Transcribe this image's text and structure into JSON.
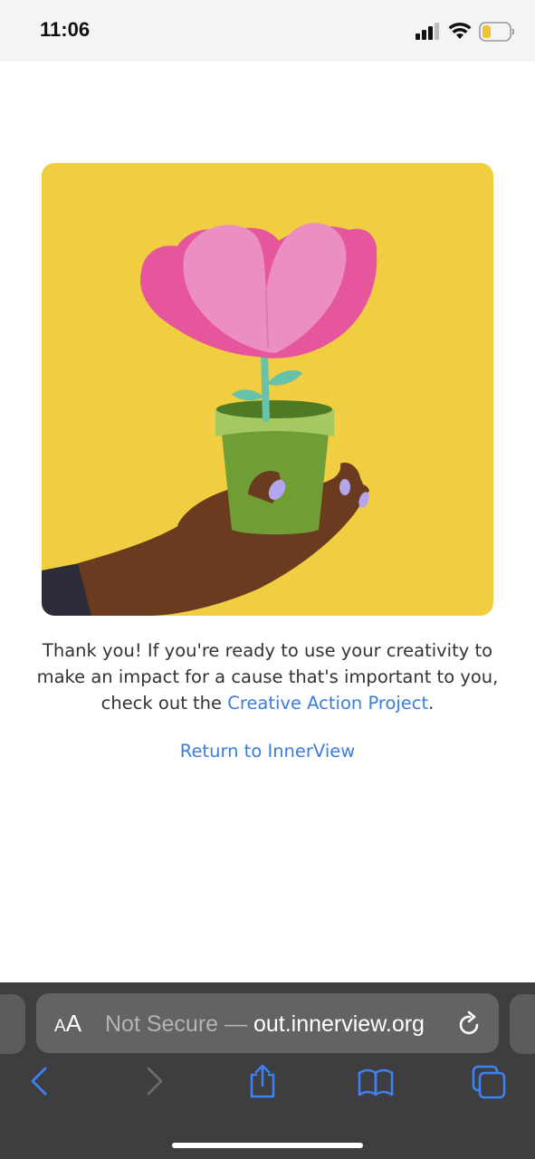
{
  "status_bar": {
    "time": "11:06"
  },
  "main": {
    "message_prefix": "Thank you! If you're ready to use your creativity to make an impact for a cause that's important to you, check out the ",
    "message_link": "Creative Action Project",
    "message_suffix": ".",
    "return_link": "Return to InnerView"
  },
  "browser": {
    "aa_large": "A",
    "aa_small": "A",
    "not_secure": "Not Secure — ",
    "domain": "out.innerview.org"
  },
  "colors": {
    "accent_link": "#3a7de0",
    "illustration_bg": "#f0cd41",
    "toolbar_icon": "#3b82f6",
    "browser_chrome": "#3e3e40"
  },
  "icons": [
    "signal-icon",
    "wifi-icon",
    "battery-icon",
    "reload-icon",
    "back-icon",
    "forward-icon",
    "share-icon",
    "bookmarks-icon",
    "tabs-icon"
  ]
}
